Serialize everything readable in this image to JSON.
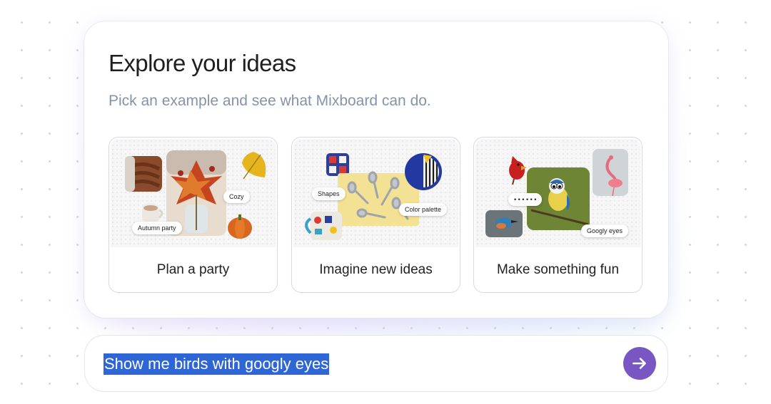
{
  "panel": {
    "title": "Explore your ideas",
    "subtitle": "Pick an example and see what Mixboard can do."
  },
  "cards": [
    {
      "label": "Plan a party",
      "chips": [
        "Cozy",
        "Autumn party"
      ],
      "images": [
        "knit-blanket",
        "autumn-leaf-bouquet",
        "yellow-leaf",
        "hot-cocoa-mug",
        "pumpkin"
      ]
    },
    {
      "label": "Imagine new ideas",
      "chips": [
        "Shapes",
        "Color palette"
      ],
      "images": [
        "patterned-tile",
        "spoons-on-yellow",
        "blue-striped-plate",
        "patterned-mug"
      ]
    },
    {
      "label": "Make something fun",
      "chips": [
        "• • • • • •",
        "Googly eyes"
      ],
      "images": [
        "red-cardinal",
        "blue-tit-bird",
        "flamingo",
        "kingfisher"
      ]
    }
  ],
  "prompt": {
    "value": "Show me birds with googly eyes"
  },
  "colors": {
    "accent": "#7857c3",
    "subtitle": "#8592ab",
    "selection": "#2f66d6"
  }
}
